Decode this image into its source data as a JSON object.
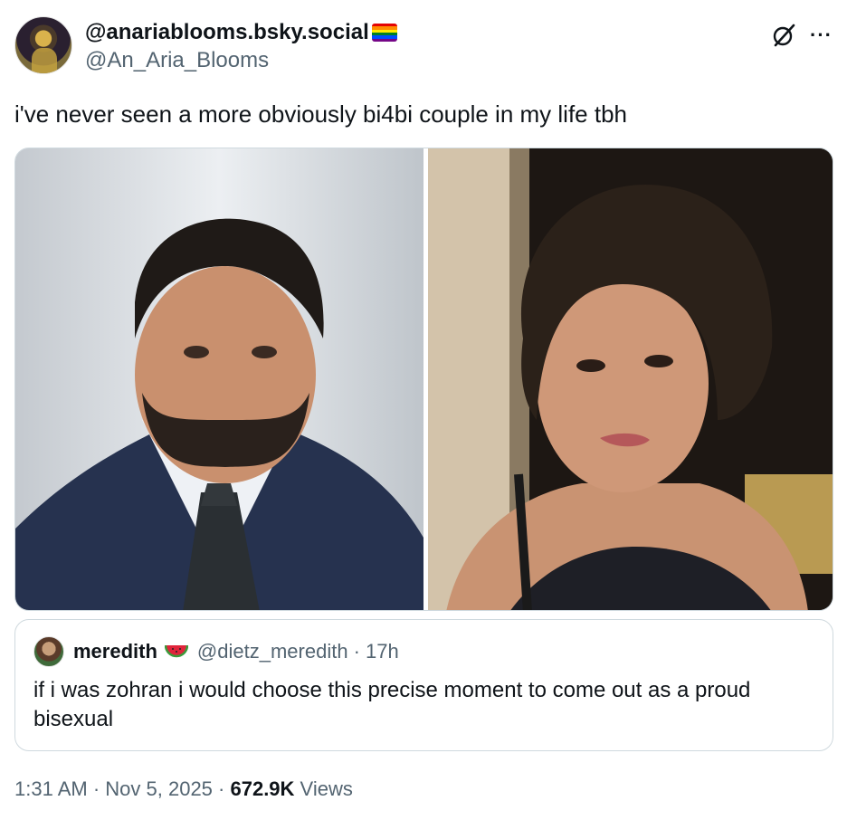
{
  "author": {
    "display_name": "@anariablooms.bsky.social",
    "handle": "@An_Aria_Blooms",
    "badge": "rainbow-flag-emoji"
  },
  "header_icons": [
    "grok-icon",
    "more-icon"
  ],
  "more_label": "···",
  "tweet": {
    "text": "i've never seen a more obviously bi4bi couple in my life tbh"
  },
  "quote": {
    "name": "meredith",
    "emoji": "watermelon-icon",
    "handle": "@dietz_meredith",
    "time": "· 17h",
    "text": "if i was zohran i would choose this precise moment to come out as a proud bisexual"
  },
  "meta": {
    "time": "1:31 AM",
    "sep1": " · ",
    "date": "Nov 5, 2025",
    "sep2": " · ",
    "views_count": "672.9K",
    "views_label": " Views"
  },
  "colors": {
    "text": "#0f1419",
    "secondary": "#536471",
    "border": "#cfd9de"
  }
}
